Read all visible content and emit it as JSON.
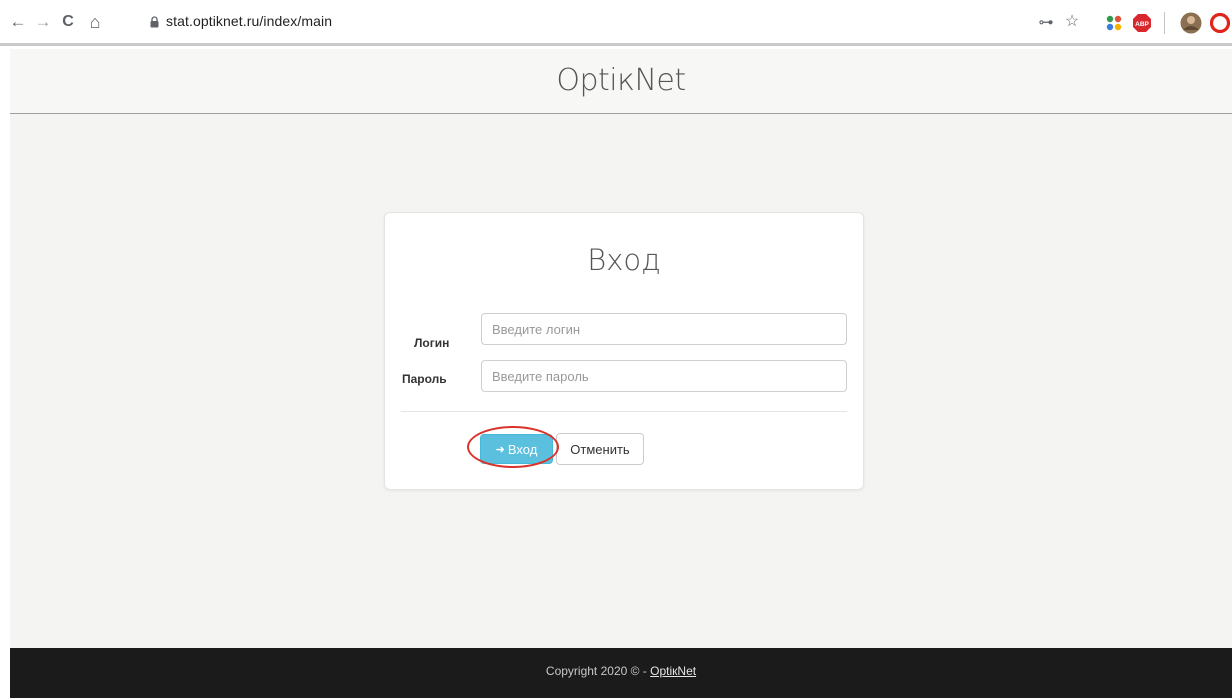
{
  "browser": {
    "url": "stat.optiknet.ru/index/main",
    "back_glyph": "←",
    "forward_glyph": "→",
    "reload_glyph": "C",
    "home_glyph": "⌂",
    "key_glyph": "⊶",
    "star_glyph": "☆",
    "adblock_label": "ABP"
  },
  "header": {
    "site_title": "OptiкNet"
  },
  "login_form": {
    "title": "Вход",
    "login_label": "Логин",
    "login_placeholder": "Введите логин",
    "login_value": "",
    "password_label": "Пароль",
    "password_placeholder": "Введите пароль",
    "password_value": "",
    "submit_label": "Вход",
    "submit_icon_glyph": "➜",
    "cancel_label": "Отменить"
  },
  "footer": {
    "copyright_text": "Copyright 2020 © - ",
    "link_text": "OptiкNet"
  },
  "colors": {
    "accent_button": "#5bc0de",
    "highlight_ring": "#d9332b",
    "footer_bg": "#1b1b1b",
    "page_bg": "#f4f4f3"
  }
}
